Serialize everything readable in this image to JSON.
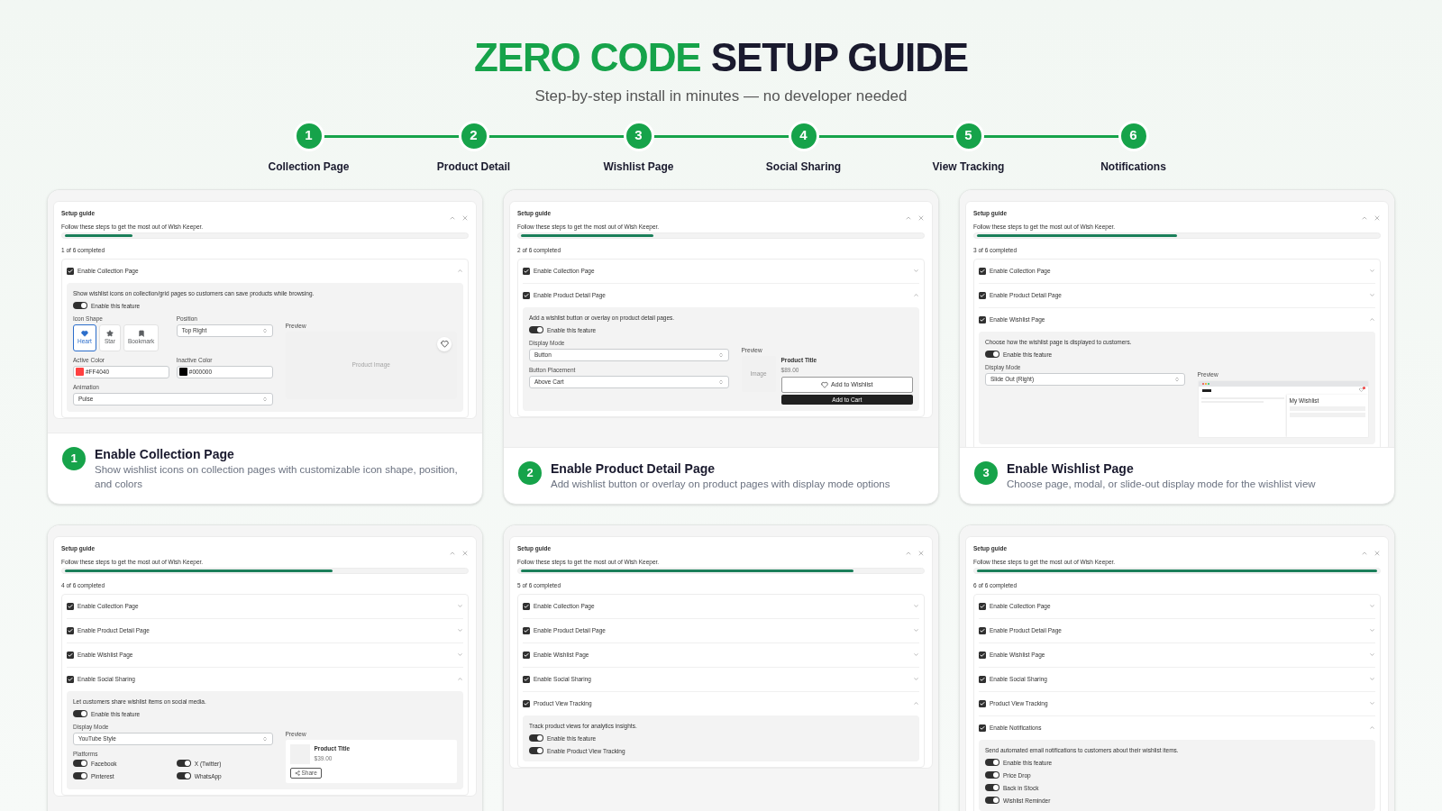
{
  "header": {
    "title_accent": "ZERO CODE",
    "title_rest": "SETUP GUIDE",
    "subtitle": "Step-by-step install in minutes — no developer needed"
  },
  "steps": [
    {
      "number": "1",
      "label": "Collection Page"
    },
    {
      "number": "2",
      "label": "Product Detail"
    },
    {
      "number": "3",
      "label": "Wishlist Page"
    },
    {
      "number": "4",
      "label": "Social Sharing"
    },
    {
      "number": "5",
      "label": "View Tracking"
    },
    {
      "number": "6",
      "label": "Notifications"
    }
  ],
  "cards": [
    {
      "number": "1",
      "title": "Enable Collection Page",
      "description": "Show wishlist icons on collection pages with customizable icon shape, position, and colors",
      "guide": {
        "title": "Setup guide",
        "subtitle": "Follow these steps to get the most out of Wish Keeper.",
        "level": 0.17,
        "progress": "1 of 6 completed",
        "items": [
          {
            "label": "Enable Collection Page",
            "checked": true,
            "expanded": true,
            "panel": {
              "description": "Show wishlist icons on collection/grid pages so customers can save products while browsing.",
              "toggles": [
                {
                  "label": "Enable this feature",
                  "on": true
                }
              ],
              "field_rows": [
                [
                  {
                    "kind": "shapes",
                    "label": "Icon Shape",
                    "options": [
                      {
                        "kind": "heart",
                        "label": "Heart",
                        "selected": true
                      },
                      {
                        "kind": "star",
                        "label": "Star",
                        "selected": false
                      },
                      {
                        "kind": "bookmark",
                        "label": "Bookmark",
                        "selected": false
                      }
                    ]
                  },
                  {
                    "kind": "select",
                    "label": "Position",
                    "value": "Top Right"
                  }
                ],
                [
                  {
                    "kind": "color",
                    "label": "Active Color",
                    "value": "#FF4040",
                    "color": "#ff4040"
                  },
                  {
                    "kind": "color",
                    "label": "Inactive Color",
                    "value": "#000000",
                    "color": "#000000"
                  }
                ],
                [
                  {
                    "kind": "select",
                    "label": "Animation",
                    "value": "Pulse"
                  }
                ]
              ],
              "preview": {
                "kind": "image",
                "label": "Preview",
                "image_label": "Product Image"
              }
            }
          }
        ]
      }
    },
    {
      "number": "2",
      "title": "Enable Product Detail Page",
      "description": "Add wishlist button or overlay on product pages with display mode options",
      "guide": {
        "title": "Setup guide",
        "subtitle": "Follow these steps to get the most out of Wish Keeper.",
        "level": 0.33,
        "progress": "2 of 6 completed",
        "items": [
          {
            "label": "Enable Collection Page",
            "checked": true,
            "expanded": false
          },
          {
            "label": "Enable Product Detail Page",
            "checked": true,
            "expanded": true,
            "panel": {
              "description": "Add a wishlist button or overlay on product detail pages.",
              "toggles": [
                {
                  "label": "Enable this feature",
                  "on": true
                }
              ],
              "field_rows": [
                [
                  {
                    "kind": "select",
                    "label": "Display Mode",
                    "value": "Button"
                  }
                ],
                [
                  {
                    "kind": "select",
                    "label": "Button Placement",
                    "value": "Above Cart"
                  }
                ]
              ],
              "preview": {
                "kind": "product",
                "label": "Preview",
                "image_label": "Image",
                "product_title": "Product Title",
                "price": "$89.00",
                "wishlist_button": "Add to Wishlist",
                "cart_button": "Add to Cart"
              }
            }
          }
        ]
      }
    },
    {
      "number": "3",
      "title": "Enable Wishlist Page",
      "description": "Choose page, modal, or slide-out display mode for the wishlist view",
      "guide": {
        "title": "Setup guide",
        "subtitle": "Follow these steps to get the most out of Wish Keeper.",
        "level": 0.5,
        "progress": "3 of 6 completed",
        "items": [
          {
            "label": "Enable Collection Page",
            "checked": true,
            "expanded": false
          },
          {
            "label": "Enable Product Detail Page",
            "checked": true,
            "expanded": false
          },
          {
            "label": "Enable Wishlist Page",
            "checked": true,
            "expanded": true,
            "panel": {
              "description": "Choose how the wishlist page is displayed to customers.",
              "toggles": [
                {
                  "label": "Enable this feature",
                  "on": true
                }
              ],
              "field_rows": [
                [
                  {
                    "kind": "select",
                    "label": "Display Mode",
                    "value": "Slide Out (Right)"
                  }
                ]
              ],
              "preview": {
                "kind": "drawer",
                "label": "Preview",
                "drawer_title": "My Wishlist"
              }
            }
          }
        ]
      }
    },
    {
      "guide": {
        "title": "Setup guide",
        "subtitle": "Follow these steps to get the most out of Wish Keeper.",
        "level": 0.67,
        "progress": "4 of 6 completed",
        "items": [
          {
            "label": "Enable Collection Page",
            "checked": true,
            "expanded": false
          },
          {
            "label": "Enable Product Detail Page",
            "checked": true,
            "expanded": false
          },
          {
            "label": "Enable Wishlist Page",
            "checked": true,
            "expanded": false
          },
          {
            "label": "Enable Social Sharing",
            "checked": true,
            "expanded": true,
            "panel": {
              "description": "Let customers share wishlist items on social media.",
              "toggles": [
                {
                  "label": "Enable this feature",
                  "on": true
                }
              ],
              "field_rows": [
                [
                  {
                    "kind": "select",
                    "label": "Display Mode",
                    "value": "YouTube Style"
                  }
                ],
                [
                  {
                    "kind": "toggles",
                    "label": "Platforms",
                    "items": [
                      {
                        "label": "Facebook",
                        "on": true
                      },
                      {
                        "label": "X (Twitter)",
                        "on": true
                      },
                      {
                        "label": "Pinterest",
                        "on": true
                      },
                      {
                        "label": "WhatsApp",
                        "on": true
                      }
                    ]
                  }
                ]
              ],
              "preview": {
                "kind": "share",
                "label": "Preview",
                "product_title": "Product Title",
                "price": "$39.00",
                "share_button": "Share"
              }
            }
          }
        ]
      }
    },
    {
      "guide": {
        "title": "Setup guide",
        "subtitle": "Follow these steps to get the most out of Wish Keeper.",
        "level": 0.83,
        "progress": "5 of 6 completed",
        "items": [
          {
            "label": "Enable Collection Page",
            "checked": true,
            "expanded": false
          },
          {
            "label": "Enable Product Detail Page",
            "checked": true,
            "expanded": false
          },
          {
            "label": "Enable Wishlist Page",
            "checked": true,
            "expanded": false
          },
          {
            "label": "Enable Social Sharing",
            "checked": true,
            "expanded": false
          },
          {
            "label": "Product View Tracking",
            "checked": true,
            "expanded": true,
            "panel": {
              "description": "Track product views for analytics insights.",
              "toggles": [
                {
                  "label": "Enable this feature",
                  "on": true
                },
                {
                  "label": "Enable Product View Tracking",
                  "on": true
                }
              ]
            }
          }
        ]
      }
    },
    {
      "guide": {
        "title": "Setup guide",
        "subtitle": "Follow these steps to get the most out of Wish Keeper.",
        "level": 1,
        "progress": "6 of 6 completed",
        "items": [
          {
            "label": "Enable Collection Page",
            "checked": true,
            "expanded": false
          },
          {
            "label": "Enable Product Detail Page",
            "checked": true,
            "expanded": false
          },
          {
            "label": "Enable Wishlist Page",
            "checked": true,
            "expanded": false
          },
          {
            "label": "Enable Social Sharing",
            "checked": true,
            "expanded": false
          },
          {
            "label": "Product View Tracking",
            "checked": true,
            "expanded": false
          },
          {
            "label": "Enable Notifications",
            "checked": true,
            "expanded": true,
            "panel": {
              "description": "Send automated email notifications to customers about their wishlist items.",
              "toggles": [
                {
                  "label": "Enable this feature",
                  "on": true
                },
                {
                  "label": "Price Drop",
                  "on": true
                },
                {
                  "label": "Back in Stock",
                  "on": true
                },
                {
                  "label": "Wishlist Reminder",
                  "on": true
                }
              ]
            }
          }
        ]
      }
    }
  ]
}
